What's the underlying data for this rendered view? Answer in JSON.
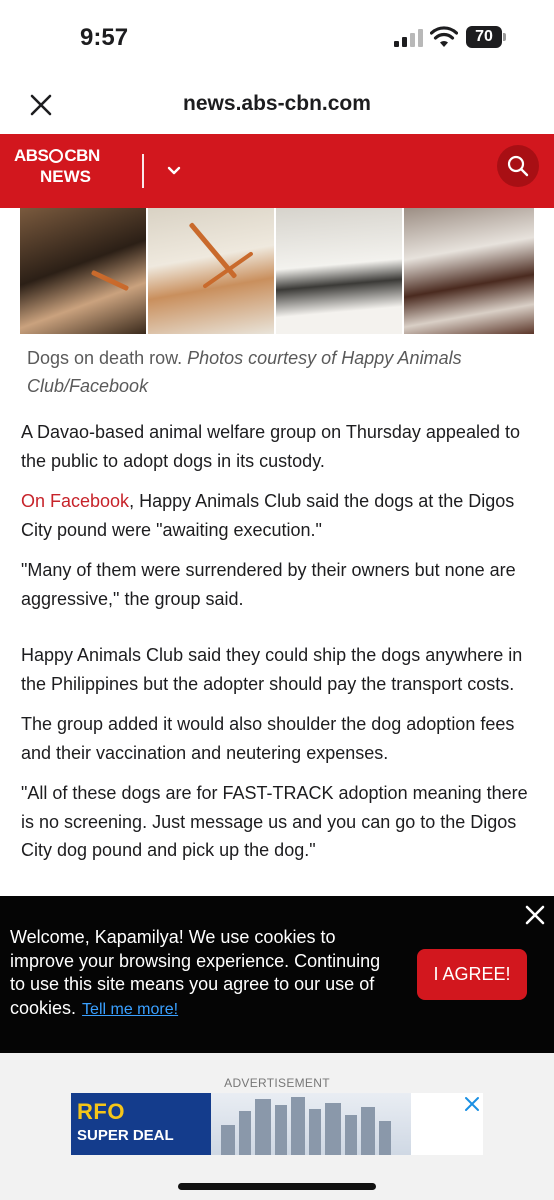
{
  "status_bar": {
    "time": "9:57",
    "battery": "70"
  },
  "browser": {
    "url": "news.abs-cbn.com"
  },
  "header": {
    "logo_top_left": "ABS",
    "logo_top_right": "CBN",
    "logo_bottom": "NEWS",
    "brand_color": "#d2171e"
  },
  "photo": {
    "caption_plain": "Dogs on death row. ",
    "caption_italic": "Photos courtesy of Happy Animals Club/Facebook"
  },
  "article": {
    "p1": "A Davao-based animal welfare group on Thursday appealed to the public to adopt dogs in its custody.",
    "p2_link": "On Facebook",
    "p2_rest": ", Happy Animals Club said the dogs at the Digos City pound were \"awaiting execution.\"",
    "p3": "\"Many of them were surrendered by their owners but none are aggressive,\" the group said.",
    "p4": "Happy Animals Club said they could ship the dogs anywhere in the Philippines but the adopter should pay the transport costs.",
    "p5": "The group added it would also shoulder the dog adoption fees and their vaccination and neutering expenses.",
    "p6": "\"All of these dogs are for FAST-TRACK adoption meaning there is no screening. Just message us and you can go to the Digos City dog pound and pick up the dog.\"",
    "link_color": "#c7232a"
  },
  "cookie_banner": {
    "message": "Welcome, Kapamilya! We use cookies to improve your browsing experience. Continuing to use this site means you agree to our use of cookies.",
    "more_link": "Tell me more!",
    "agree_label": "I AGREE!"
  },
  "ad": {
    "label": "ADVERTISEMENT",
    "brand": "RFO",
    "tagline": "SUPER DEAL"
  }
}
